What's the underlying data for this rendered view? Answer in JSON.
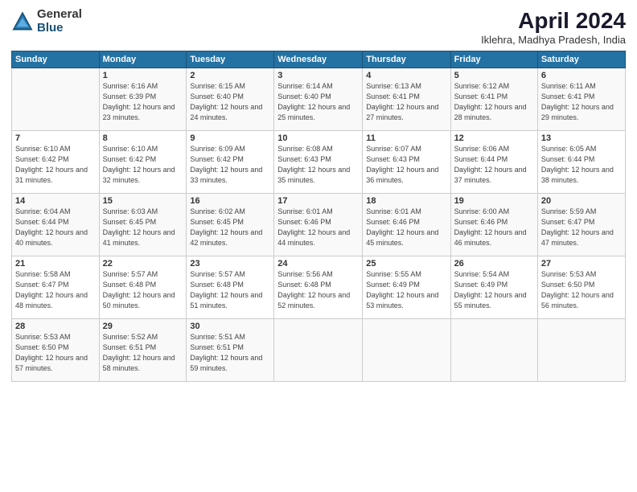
{
  "logo": {
    "general": "General",
    "blue": "Blue"
  },
  "header": {
    "title": "April 2024",
    "location": "Iklehra, Madhya Pradesh, India"
  },
  "days_of_week": [
    "Sunday",
    "Monday",
    "Tuesday",
    "Wednesday",
    "Thursday",
    "Friday",
    "Saturday"
  ],
  "weeks": [
    [
      {
        "day": "",
        "sunrise": "",
        "sunset": "",
        "daylight": ""
      },
      {
        "day": "1",
        "sunrise": "Sunrise: 6:16 AM",
        "sunset": "Sunset: 6:39 PM",
        "daylight": "Daylight: 12 hours and 23 minutes."
      },
      {
        "day": "2",
        "sunrise": "Sunrise: 6:15 AM",
        "sunset": "Sunset: 6:40 PM",
        "daylight": "Daylight: 12 hours and 24 minutes."
      },
      {
        "day": "3",
        "sunrise": "Sunrise: 6:14 AM",
        "sunset": "Sunset: 6:40 PM",
        "daylight": "Daylight: 12 hours and 25 minutes."
      },
      {
        "day": "4",
        "sunrise": "Sunrise: 6:13 AM",
        "sunset": "Sunset: 6:41 PM",
        "daylight": "Daylight: 12 hours and 27 minutes."
      },
      {
        "day": "5",
        "sunrise": "Sunrise: 6:12 AM",
        "sunset": "Sunset: 6:41 PM",
        "daylight": "Daylight: 12 hours and 28 minutes."
      },
      {
        "day": "6",
        "sunrise": "Sunrise: 6:11 AM",
        "sunset": "Sunset: 6:41 PM",
        "daylight": "Daylight: 12 hours and 29 minutes."
      }
    ],
    [
      {
        "day": "7",
        "sunrise": "Sunrise: 6:10 AM",
        "sunset": "Sunset: 6:42 PM",
        "daylight": "Daylight: 12 hours and 31 minutes."
      },
      {
        "day": "8",
        "sunrise": "Sunrise: 6:10 AM",
        "sunset": "Sunset: 6:42 PM",
        "daylight": "Daylight: 12 hours and 32 minutes."
      },
      {
        "day": "9",
        "sunrise": "Sunrise: 6:09 AM",
        "sunset": "Sunset: 6:42 PM",
        "daylight": "Daylight: 12 hours and 33 minutes."
      },
      {
        "day": "10",
        "sunrise": "Sunrise: 6:08 AM",
        "sunset": "Sunset: 6:43 PM",
        "daylight": "Daylight: 12 hours and 35 minutes."
      },
      {
        "day": "11",
        "sunrise": "Sunrise: 6:07 AM",
        "sunset": "Sunset: 6:43 PM",
        "daylight": "Daylight: 12 hours and 36 minutes."
      },
      {
        "day": "12",
        "sunrise": "Sunrise: 6:06 AM",
        "sunset": "Sunset: 6:44 PM",
        "daylight": "Daylight: 12 hours and 37 minutes."
      },
      {
        "day": "13",
        "sunrise": "Sunrise: 6:05 AM",
        "sunset": "Sunset: 6:44 PM",
        "daylight": "Daylight: 12 hours and 38 minutes."
      }
    ],
    [
      {
        "day": "14",
        "sunrise": "Sunrise: 6:04 AM",
        "sunset": "Sunset: 6:44 PM",
        "daylight": "Daylight: 12 hours and 40 minutes."
      },
      {
        "day": "15",
        "sunrise": "Sunrise: 6:03 AM",
        "sunset": "Sunset: 6:45 PM",
        "daylight": "Daylight: 12 hours and 41 minutes."
      },
      {
        "day": "16",
        "sunrise": "Sunrise: 6:02 AM",
        "sunset": "Sunset: 6:45 PM",
        "daylight": "Daylight: 12 hours and 42 minutes."
      },
      {
        "day": "17",
        "sunrise": "Sunrise: 6:01 AM",
        "sunset": "Sunset: 6:46 PM",
        "daylight": "Daylight: 12 hours and 44 minutes."
      },
      {
        "day": "18",
        "sunrise": "Sunrise: 6:01 AM",
        "sunset": "Sunset: 6:46 PM",
        "daylight": "Daylight: 12 hours and 45 minutes."
      },
      {
        "day": "19",
        "sunrise": "Sunrise: 6:00 AM",
        "sunset": "Sunset: 6:46 PM",
        "daylight": "Daylight: 12 hours and 46 minutes."
      },
      {
        "day": "20",
        "sunrise": "Sunrise: 5:59 AM",
        "sunset": "Sunset: 6:47 PM",
        "daylight": "Daylight: 12 hours and 47 minutes."
      }
    ],
    [
      {
        "day": "21",
        "sunrise": "Sunrise: 5:58 AM",
        "sunset": "Sunset: 6:47 PM",
        "daylight": "Daylight: 12 hours and 48 minutes."
      },
      {
        "day": "22",
        "sunrise": "Sunrise: 5:57 AM",
        "sunset": "Sunset: 6:48 PM",
        "daylight": "Daylight: 12 hours and 50 minutes."
      },
      {
        "day": "23",
        "sunrise": "Sunrise: 5:57 AM",
        "sunset": "Sunset: 6:48 PM",
        "daylight": "Daylight: 12 hours and 51 minutes."
      },
      {
        "day": "24",
        "sunrise": "Sunrise: 5:56 AM",
        "sunset": "Sunset: 6:48 PM",
        "daylight": "Daylight: 12 hours and 52 minutes."
      },
      {
        "day": "25",
        "sunrise": "Sunrise: 5:55 AM",
        "sunset": "Sunset: 6:49 PM",
        "daylight": "Daylight: 12 hours and 53 minutes."
      },
      {
        "day": "26",
        "sunrise": "Sunrise: 5:54 AM",
        "sunset": "Sunset: 6:49 PM",
        "daylight": "Daylight: 12 hours and 55 minutes."
      },
      {
        "day": "27",
        "sunrise": "Sunrise: 5:53 AM",
        "sunset": "Sunset: 6:50 PM",
        "daylight": "Daylight: 12 hours and 56 minutes."
      }
    ],
    [
      {
        "day": "28",
        "sunrise": "Sunrise: 5:53 AM",
        "sunset": "Sunset: 6:50 PM",
        "daylight": "Daylight: 12 hours and 57 minutes."
      },
      {
        "day": "29",
        "sunrise": "Sunrise: 5:52 AM",
        "sunset": "Sunset: 6:51 PM",
        "daylight": "Daylight: 12 hours and 58 minutes."
      },
      {
        "day": "30",
        "sunrise": "Sunrise: 5:51 AM",
        "sunset": "Sunset: 6:51 PM",
        "daylight": "Daylight: 12 hours and 59 minutes."
      },
      {
        "day": "",
        "sunrise": "",
        "sunset": "",
        "daylight": ""
      },
      {
        "day": "",
        "sunrise": "",
        "sunset": "",
        "daylight": ""
      },
      {
        "day": "",
        "sunrise": "",
        "sunset": "",
        "daylight": ""
      },
      {
        "day": "",
        "sunrise": "",
        "sunset": "",
        "daylight": ""
      }
    ]
  ]
}
